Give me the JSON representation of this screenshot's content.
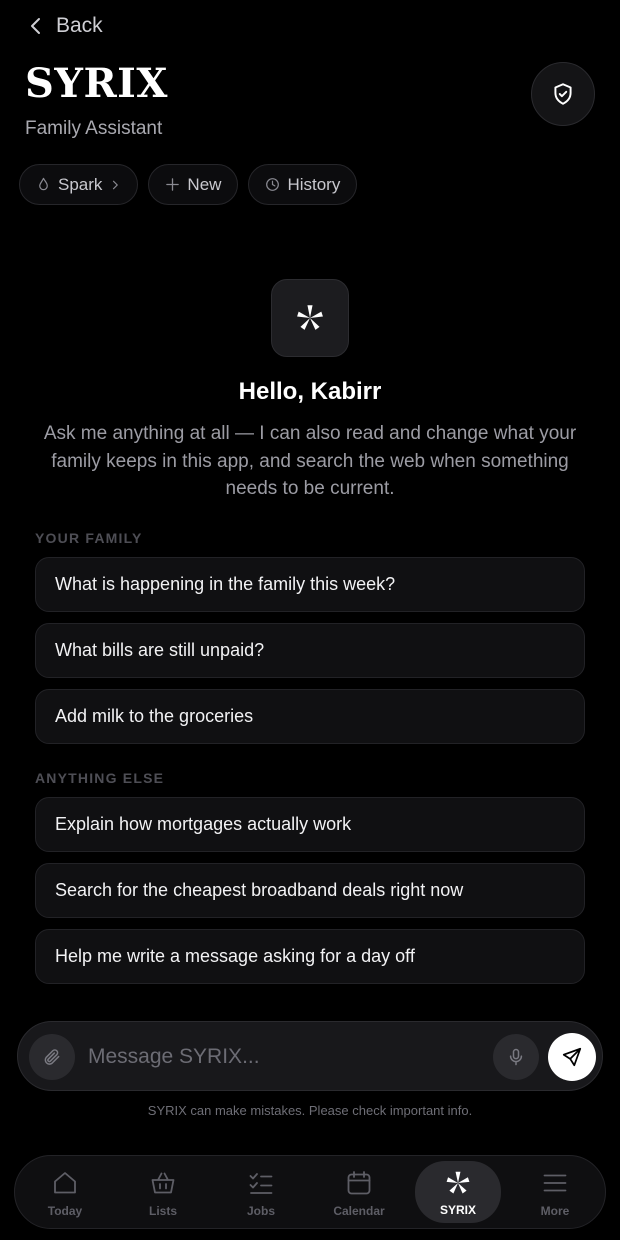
{
  "header": {
    "back_label": "Back",
    "title": "SYRIX",
    "subtitle": "Family Assistant"
  },
  "chips": [
    {
      "label": "Spark",
      "icon": "flame-icon"
    },
    {
      "label": "New",
      "icon": "plus-icon"
    },
    {
      "label": "History",
      "icon": "clock-icon"
    }
  ],
  "hero": {
    "greeting": "Hello, Kabirr",
    "intro": "Ask me anything at all — I can also read and change what your family keeps in this app, and search the web when something needs to be current."
  },
  "sections": [
    {
      "label": "YOUR FAMILY",
      "items": [
        "What is happening in the family this week?",
        "What bills are still unpaid?",
        "Add milk to the groceries"
      ]
    },
    {
      "label": "ANYTHING ELSE",
      "items": [
        "Explain how mortgages actually work",
        "Search for the cheapest broadband deals right now",
        "Help me write a message asking for a day off"
      ]
    }
  ],
  "composer": {
    "placeholder": "Message SYRIX...",
    "value": ""
  },
  "disclaimer": "SYRIX can make mistakes. Please check important info.",
  "nav": [
    {
      "label": "Today",
      "icon": "home-icon",
      "active": false
    },
    {
      "label": "Lists",
      "icon": "basket-icon",
      "active": false
    },
    {
      "label": "Jobs",
      "icon": "checklist-icon",
      "active": false
    },
    {
      "label": "Calendar",
      "icon": "calendar-icon",
      "active": false
    },
    {
      "label": "SYRIX",
      "icon": "syrix-star-icon",
      "active": true
    },
    {
      "label": "More",
      "icon": "menu-icon",
      "active": false
    }
  ],
  "colors": {
    "background": "#000000",
    "card": "#101012",
    "border": "#222226",
    "accent": "#ffffff",
    "muted_text": "#9c9ca4"
  }
}
